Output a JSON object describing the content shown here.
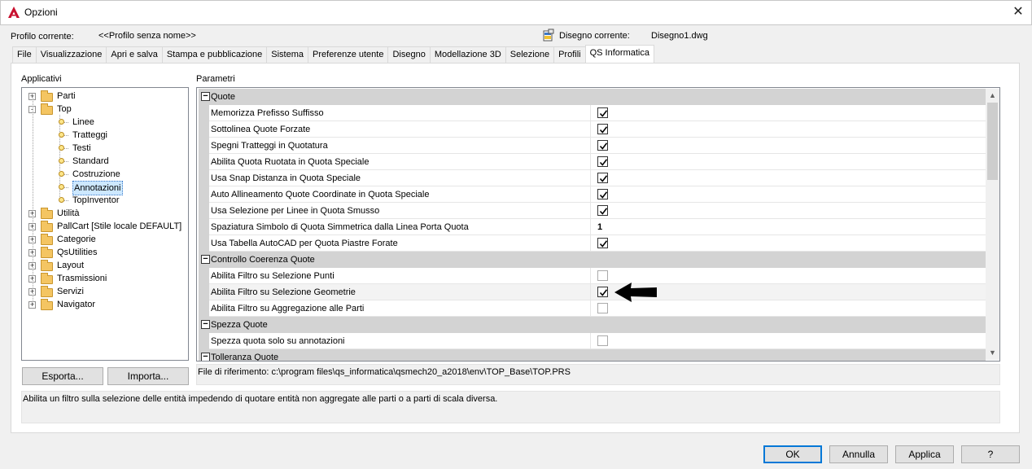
{
  "window": {
    "title": "Opzioni"
  },
  "profile": {
    "current_label": "Profilo corrente:",
    "current_value": "<<Profilo senza nome>>",
    "drawing_label": "Disegno corrente:",
    "drawing_value": "Disegno1.dwg"
  },
  "tabs": [
    "File",
    "Visualizzazione",
    "Apri e salva",
    "Stampa e pubblicazione",
    "Sistema",
    "Preferenze utente",
    "Disegno",
    "Modellazione 3D",
    "Selezione",
    "Profili",
    "QS Informatica"
  ],
  "active_tab": "QS Informatica",
  "left_panel": {
    "label": "Applicativi",
    "tree": [
      {
        "label": "Parti",
        "level": 0,
        "type": "folder",
        "expander": "+"
      },
      {
        "label": "Top",
        "level": 0,
        "type": "folder",
        "expander": "-"
      },
      {
        "label": "Linee",
        "level": 1,
        "type": "leaf"
      },
      {
        "label": "Tratteggi",
        "level": 1,
        "type": "leaf"
      },
      {
        "label": "Testi",
        "level": 1,
        "type": "leaf"
      },
      {
        "label": "Standard",
        "level": 1,
        "type": "leaf"
      },
      {
        "label": "Costruzione",
        "level": 1,
        "type": "leaf"
      },
      {
        "label": "Annotazioni",
        "level": 1,
        "type": "leaf",
        "selected": true
      },
      {
        "label": "TopInventor",
        "level": 1,
        "type": "leaf"
      },
      {
        "label": "Utilità",
        "level": 0,
        "type": "folder",
        "expander": "+"
      },
      {
        "label": "PallCart [Stile locale DEFAULT]",
        "level": 0,
        "type": "folder",
        "expander": "+"
      },
      {
        "label": "Categorie",
        "level": 0,
        "type": "folder",
        "expander": "+"
      },
      {
        "label": "QsUtilities",
        "level": 0,
        "type": "folder",
        "expander": "+"
      },
      {
        "label": "Layout",
        "level": 0,
        "type": "folder",
        "expander": "+"
      },
      {
        "label": "Trasmissioni",
        "level": 0,
        "type": "folder",
        "expander": "+"
      },
      {
        "label": "Servizi",
        "level": 0,
        "type": "folder",
        "expander": "+"
      },
      {
        "label": "Navigator",
        "level": 0,
        "type": "folder",
        "expander": "+"
      }
    ],
    "export_button": "Esporta...",
    "import_button": "Importa..."
  },
  "right_panel": {
    "label": "Parametri",
    "rows": [
      {
        "kind": "category",
        "label": "Quote"
      },
      {
        "kind": "param",
        "label": "Memorizza Prefisso Suffisso",
        "value_type": "check",
        "checked": true
      },
      {
        "kind": "param",
        "label": "Sottolinea Quote Forzate",
        "value_type": "check",
        "checked": true
      },
      {
        "kind": "param",
        "label": "Spegni Tratteggi in Quotatura",
        "value_type": "check",
        "checked": true
      },
      {
        "kind": "param",
        "label": "Abilita Quota Ruotata in Quota Speciale",
        "value_type": "check",
        "checked": true
      },
      {
        "kind": "param",
        "label": "Usa Snap Distanza in Quota Speciale",
        "value_type": "check",
        "checked": true
      },
      {
        "kind": "param",
        "label": "Auto Allineamento Quote Coordinate in Quota Speciale",
        "value_type": "check",
        "checked": true
      },
      {
        "kind": "param",
        "label": "Usa Selezione per Linee in Quota Smusso",
        "value_type": "check",
        "checked": true
      },
      {
        "kind": "param",
        "label": "Spaziatura Simbolo di Quota Simmetrica dalla Linea Porta Quota",
        "value_type": "text",
        "value": "1"
      },
      {
        "kind": "param",
        "label": "Usa Tabella AutoCAD per Quota Piastre Forate",
        "value_type": "check",
        "checked": true
      },
      {
        "kind": "category",
        "label": "Controllo Coerenza Quote"
      },
      {
        "kind": "param",
        "label": "Abilita Filtro su Selezione Punti",
        "value_type": "check",
        "checked": false
      },
      {
        "kind": "param",
        "label": "Abilita Filtro su Selezione Geometrie",
        "value_type": "check",
        "checked": true,
        "highlight": true
      },
      {
        "kind": "param",
        "label": "Abilita Filtro su Aggregazione alle Parti",
        "value_type": "check",
        "checked": false
      },
      {
        "kind": "category",
        "label": "Spezza Quote"
      },
      {
        "kind": "param",
        "label": "Spezza quota solo su annotazioni",
        "value_type": "check",
        "checked": false
      },
      {
        "kind": "category",
        "label": "Tolleranza Quote"
      }
    ],
    "reference_file": "File di riferimento: c:\\program files\\qs_informatica\\qsmech20_a2018\\env\\TOP_Base\\TOP.PRS"
  },
  "description": "Abilita un filtro sulla selezione delle entità impedendo di quotare entità non aggregate alle parti o a parti di scala diversa.",
  "buttons": {
    "ok": "OK",
    "cancel": "Annulla",
    "apply": "Applica",
    "help": "?"
  },
  "icons": {
    "app": "autocad-logo-icon",
    "drawing": "drawing-file-icon",
    "close": "close-icon",
    "pointer": "arrow-left-icon"
  },
  "colors": {
    "app_icon": "#c8102e",
    "category_bg": "#d3d3d3",
    "default_button_border": "#0078d7",
    "folder": "#f4c562"
  }
}
